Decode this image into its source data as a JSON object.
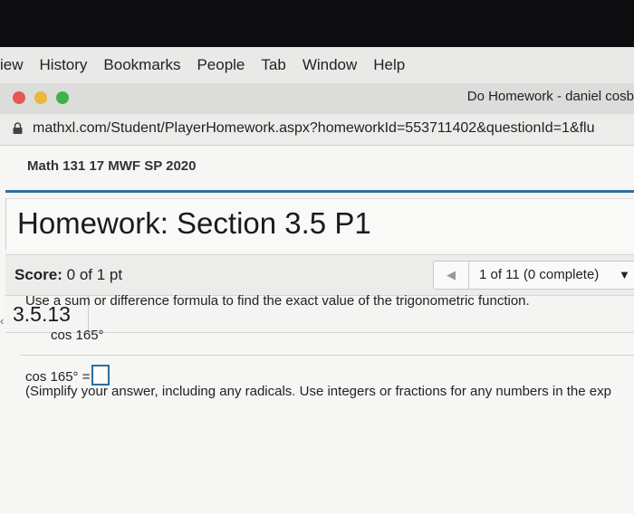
{
  "menubar": {
    "items": [
      "iew",
      "History",
      "Bookmarks",
      "People",
      "Tab",
      "Window",
      "Help"
    ]
  },
  "window": {
    "tab_title": "Do Homework - daniel cosb",
    "url": "mathxl.com/Student/PlayerHomework.aspx?homeworkId=553711402&questionId=1&flu"
  },
  "course": {
    "name": "Math 131 17 MWF SP 2020"
  },
  "homework": {
    "title": "Homework: Section 3.5 P1",
    "score_label": "Score:",
    "score_value": "0 of 1 pt",
    "nav_label": "1 of 11 (0 complete)"
  },
  "question": {
    "number": "3.5.13",
    "prompt": "Use a sum or difference formula to find the exact value of the trigonometric function.",
    "expression": "cos 165°",
    "answer_prefix": "cos 165° =",
    "hint": "(Simplify your answer, including any radicals. Use integers or fractions for any numbers in the exp"
  },
  "colors": {
    "accent_blue": "#2d6f9b",
    "close_dot": "#e6574f",
    "minimize_dot": "#e9b83c",
    "zoom_dot": "#3cb34a"
  }
}
